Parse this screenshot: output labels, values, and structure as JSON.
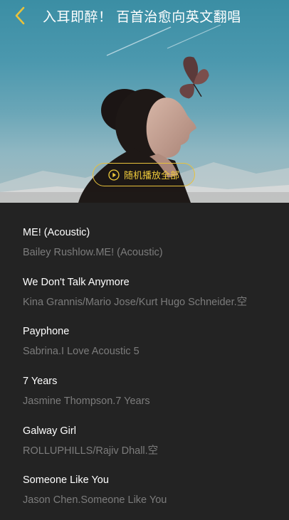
{
  "header": {
    "title": "入耳即醉！ 百首治愈向英文翻唱",
    "back_icon": "chevron-left-icon",
    "accent": "#e9c23b"
  },
  "shuffle_button": {
    "label": "随机播放全部",
    "icon": "play-circle-icon"
  },
  "songs": [
    {
      "name": "ME! (Acoustic)",
      "subtitle": "Bailey Rushlow.ME! (Acoustic)"
    },
    {
      "name": "We Don't Talk Anymore",
      "subtitle": "Kina Grannis/Mario Jose/Kurt Hugo Schneider.空"
    },
    {
      "name": "Payphone",
      "subtitle": "Sabrina.I Love Acoustic 5"
    },
    {
      "name": "7 Years",
      "subtitle": "Jasmine Thompson.7 Years"
    },
    {
      "name": "Galway Girl",
      "subtitle": "ROLLUPHILLS/Rajiv Dhall.空"
    },
    {
      "name": "Someone Like You",
      "subtitle": "Jason Chen.Someone Like You"
    }
  ]
}
